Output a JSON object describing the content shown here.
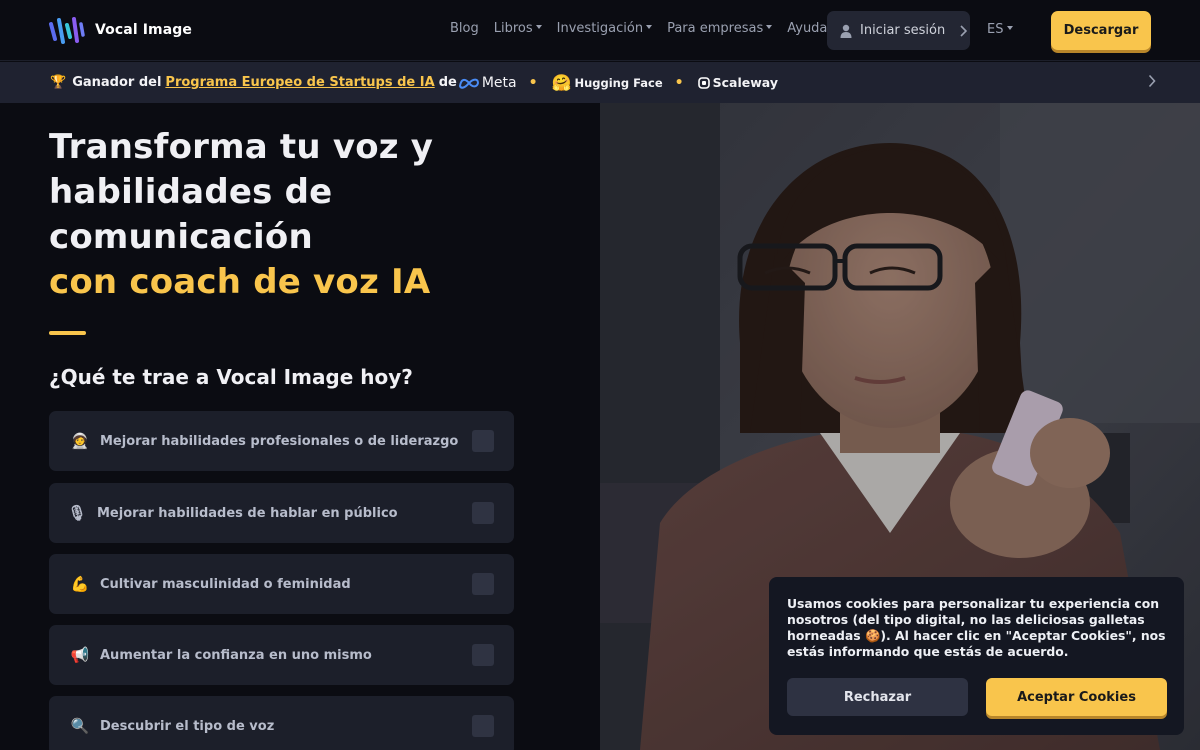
{
  "nav": {
    "logo_text": "Vocal Image",
    "links": [
      "Blog",
      "Libros",
      "Investigación",
      "Para empresas",
      "Ayuda"
    ],
    "login_label": "Iniciar sesión",
    "lang": "ES",
    "download_label": "Descargar"
  },
  "banner": {
    "prefix": "Ganador del",
    "link_text": "Programa Europeo de Startups de IA",
    "connector": "de",
    "brands": [
      "Meta",
      "Hugging Face",
      "Scaleway"
    ]
  },
  "hero": {
    "line1": "Transforma tu voz y",
    "line2": "habilidades de",
    "line3": "comunicación",
    "accent": "con coach de voz IA"
  },
  "question": "¿Qué te trae a Vocal Image hoy?",
  "options": [
    {
      "emoji": "🧑‍🚀",
      "label": "Mejorar habilidades profesionales o de liderazgo"
    },
    {
      "emoji": "🎙",
      "label": "Mejorar habilidades de hablar en público"
    },
    {
      "emoji": "💪",
      "label": "Cultivar masculinidad o feminidad"
    },
    {
      "emoji": "📢",
      "label": "Aumentar la confianza en uno mismo"
    },
    {
      "emoji": "🔍",
      "label": "Descubrir el tipo de voz"
    }
  ],
  "cookie": {
    "text": "Usamos cookies para personalizar tu experiencia con nosotros (del tipo digital, no las deliciosas galletas horneadas 🍪). Al hacer clic en \"Aceptar Cookies\", nos estás informando que estás de acuerdo.",
    "reject_label": "Rechazar",
    "accept_label": "Aceptar Cookies"
  },
  "colors": {
    "accent": "#f9c54c",
    "background": "#0b0c12",
    "card": "#1c1f2a"
  }
}
